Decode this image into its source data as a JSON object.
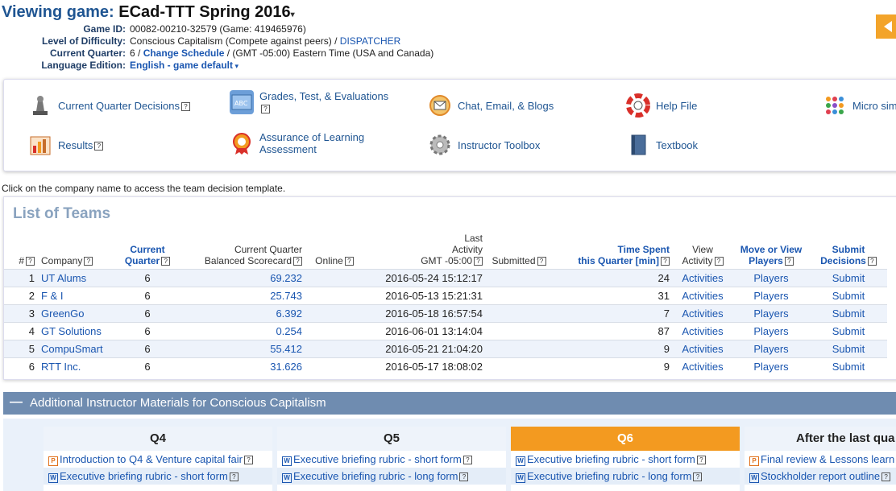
{
  "header": {
    "title_label": "Viewing game:",
    "title_value": "ECad-TTT Spring 2016",
    "game_id_label": "Game ID:",
    "game_id_value": "00082-00210-32579 (Game: 419465976)",
    "difficulty_label": "Level of Difficulty:",
    "difficulty_value": "Conscious Capitalism (Compete against peers) / ",
    "difficulty_link": "DISPATCHER",
    "quarter_label": "Current Quarter:",
    "quarter_value": "6 / ",
    "change_schedule": "Change Schedule",
    "timezone": " / (GMT -05:00) Eastern Time (USA and Canada)",
    "language_label": "Language Edition:",
    "language_value": "English - game default"
  },
  "nav": {
    "decisions": "Current Quarter Decisions",
    "grades": "Grades, Test, & Evaluations",
    "chat": "Chat, Email, & Blogs",
    "help": "Help File",
    "micro": "Micro simu",
    "results": "Results",
    "assurance": "Assurance of Learning Assessment",
    "toolbox": "Instructor Toolbox",
    "textbook": "Textbook"
  },
  "hint": "Click on the company name to access the team decision template.",
  "teams": {
    "heading": "List of Teams",
    "columns": {
      "num": "#",
      "company": "Company",
      "current_quarter_1": "Current",
      "current_quarter_2": "Quarter",
      "bsc_1": "Current Quarter",
      "bsc_2": "Balanced Scorecard",
      "online": "Online",
      "last_1": "Last",
      "last_2": "Activity",
      "last_3": "GMT -05:00",
      "submitted": "Submitted",
      "time_1": "Time Spent",
      "time_2": "this Quarter [min]",
      "view_1": "View",
      "view_2": "Activity",
      "players_1": "Move or View",
      "players_2": "Players",
      "submit_1": "Submit",
      "submit_2": "Decisions"
    },
    "rows": [
      {
        "num": "1",
        "company": "UT Alums",
        "quarter": "6",
        "bsc": "69.232",
        "last": "2016-05-24 15:12:17",
        "time": "24",
        "view": "Activities",
        "players": "Players",
        "submit": "Submit"
      },
      {
        "num": "2",
        "company": "F & I",
        "quarter": "6",
        "bsc": "25.743",
        "last": "2016-05-13 15:21:31",
        "time": "31",
        "view": "Activities",
        "players": "Players",
        "submit": "Submit"
      },
      {
        "num": "3",
        "company": "GreenGo",
        "quarter": "6",
        "bsc": "6.392",
        "last": "2016-05-18 16:57:54",
        "time": "7",
        "view": "Activities",
        "players": "Players",
        "submit": "Submit"
      },
      {
        "num": "4",
        "company": "GT Solutions",
        "quarter": "6",
        "bsc": "0.254",
        "last": "2016-06-01 13:14:04",
        "time": "87",
        "view": "Activities",
        "players": "Players",
        "submit": "Submit"
      },
      {
        "num": "5",
        "company": "CompuSmart",
        "quarter": "6",
        "bsc": "55.412",
        "last": "2016-05-21 21:04:20",
        "time": "9",
        "view": "Activities",
        "players": "Players",
        "submit": "Submit"
      },
      {
        "num": "6",
        "company": "RTT Inc.",
        "quarter": "6",
        "bsc": "31.626",
        "last": "2016-05-17 18:08:02",
        "time": "9",
        "view": "Activities",
        "players": "Players",
        "submit": "Submit"
      }
    ]
  },
  "materials": {
    "title": "Additional Instructor Materials for Conscious Capitalism",
    "toggle": "—",
    "columns": [
      {
        "head": "Q4",
        "items": [
          {
            "icon": "P",
            "label": "Introduction to Q4 & Venture capital fair"
          },
          {
            "icon": "W",
            "label": "Executive briefing rubric - short form"
          }
        ]
      },
      {
        "head": "Q5",
        "items": [
          {
            "icon": "W",
            "label": "Executive briefing rubric - short form"
          },
          {
            "icon": "W",
            "label": "Executive briefing rubric - long form"
          }
        ]
      },
      {
        "head": "Q6",
        "items": [
          {
            "icon": "W",
            "label": "Executive briefing rubric - short form"
          },
          {
            "icon": "W",
            "label": "Executive briefing rubric - long form"
          }
        ]
      },
      {
        "head": "After the last qua",
        "items": [
          {
            "icon": "P",
            "label": "Final review & Lessons learn"
          },
          {
            "icon": "W",
            "label": "Stockholder report outline"
          }
        ]
      }
    ]
  },
  "help_glyph": "?",
  "colors": {
    "accent_orange": "#f39a20",
    "header_bar": "#6f8cb0",
    "link_blue": "#1a56b0"
  }
}
